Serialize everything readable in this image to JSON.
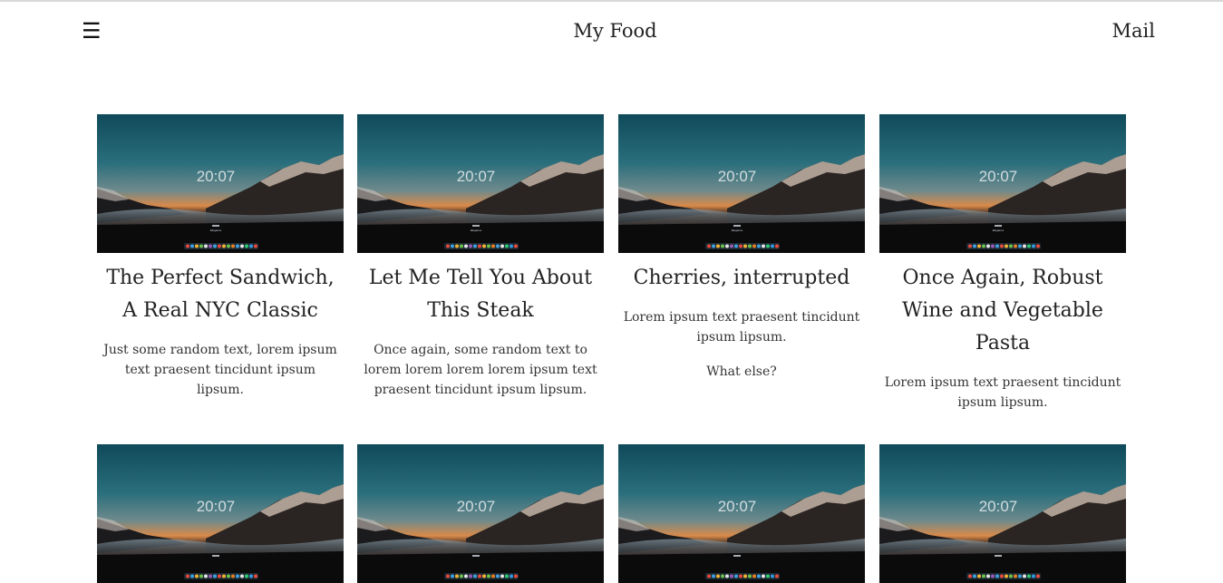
{
  "header": {
    "menu_icon": "☰",
    "brand": "My Food",
    "mail": "Mail"
  },
  "thumbnail": {
    "clock": "20:07",
    "caption": "Elegance"
  },
  "cards": [
    {
      "title": "The Perfect Sandwich, A Real NYC Classic",
      "text": "Just some random text, lorem ipsum text praesent tincidunt ipsum lipsum.",
      "extra": ""
    },
    {
      "title": "Let Me Tell You About This Steak",
      "text": "Once again, some random text to lorem lorem lorem lorem ipsum text praesent tincidunt ipsum lipsum.",
      "extra": ""
    },
    {
      "title": "Cherries, interrupted",
      "text": "Lorem ipsum text praesent tincidunt ipsum lipsum.",
      "extra": "What else?"
    },
    {
      "title": "Once Again, Robust Wine and Vegetable Pasta",
      "text": "Lorem ipsum text praesent tincidunt ipsum lipsum.",
      "extra": ""
    }
  ],
  "row2": {
    "clock": "20:07"
  }
}
